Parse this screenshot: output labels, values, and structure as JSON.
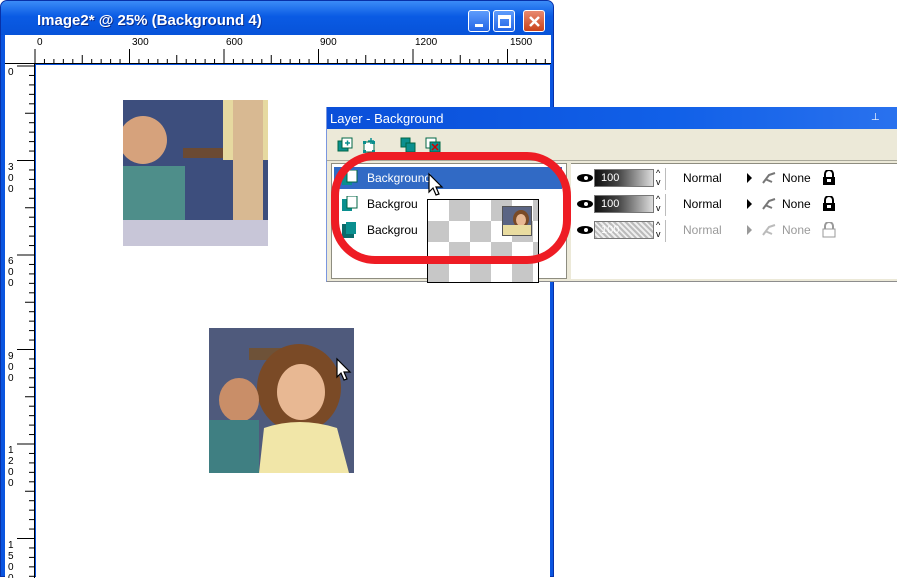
{
  "image_window": {
    "title": "Image2* @  25% (Background 4)",
    "controls": [
      "minimize-icon",
      "maximize-icon",
      "close-icon"
    ],
    "ruler_top_labels": [
      "0",
      "300",
      "600",
      "900",
      "1200",
      "1500"
    ],
    "ruler_left_labels": [
      "0",
      "300",
      "600",
      "900",
      "1200",
      "1500"
    ]
  },
  "layer_palette": {
    "title": "Layer - Background",
    "toolbar_icons": [
      "new-raster-layer-icon",
      "new-vector-layer-icon",
      "duplicate-layer-icon",
      "delete-layer-icon"
    ],
    "pin": "⊥",
    "layers": [
      {
        "name": "Background",
        "opacity": "100",
        "blend": "Normal",
        "mask": "None",
        "selected": true
      },
      {
        "name": "Backgrou",
        "opacity": "100",
        "blend": "Normal",
        "mask": "None",
        "selected": false
      },
      {
        "name": "Backgrou",
        "opacity": "100",
        "blend": "Normal",
        "mask": "None",
        "selected": false,
        "disabled": true
      }
    ]
  },
  "colors": {
    "titlebar": "#0a5be4",
    "highlight": "#ee1c24",
    "selection": "#316ac5"
  }
}
